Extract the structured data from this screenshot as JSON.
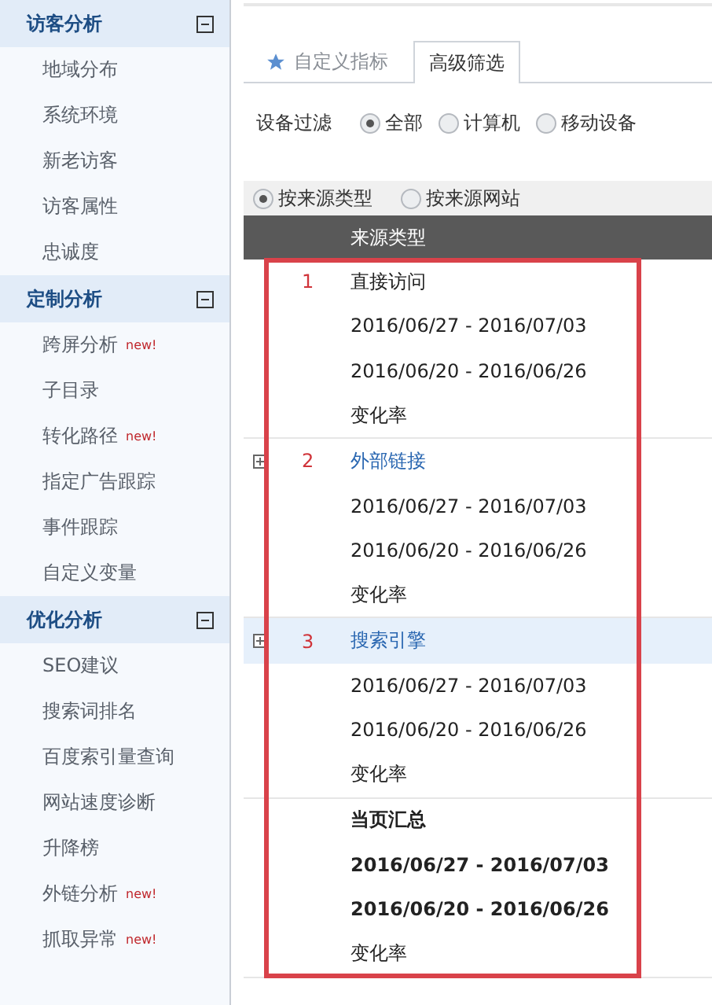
{
  "sidebar": {
    "sections": [
      {
        "title": "访客分析",
        "expanded": true,
        "items": [
          {
            "label": "地域分布"
          },
          {
            "label": "系统环境"
          },
          {
            "label": "新老访客"
          },
          {
            "label": "访客属性"
          },
          {
            "label": "忠诚度"
          }
        ]
      },
      {
        "title": "定制分析",
        "expanded": true,
        "items": [
          {
            "label": "跨屏分析",
            "badge": "new!"
          },
          {
            "label": "子目录"
          },
          {
            "label": "转化路径",
            "badge": "new!"
          },
          {
            "label": "指定广告跟踪"
          },
          {
            "label": "事件跟踪"
          },
          {
            "label": "自定义变量"
          }
        ]
      },
      {
        "title": "优化分析",
        "expanded": true,
        "items": [
          {
            "label": "SEO建议"
          },
          {
            "label": "搜索词排名"
          },
          {
            "label": "百度索引量查询"
          },
          {
            "label": "网站速度诊断"
          },
          {
            "label": "升降榜"
          },
          {
            "label": "外链分析",
            "badge": "new!"
          },
          {
            "label": "抓取异常",
            "badge": "new!"
          }
        ]
      }
    ]
  },
  "tabs": [
    {
      "label": "自定义指标",
      "kind": "starred",
      "selected": false
    },
    {
      "label": "高级筛选",
      "kind": "plain",
      "selected": true
    }
  ],
  "device_filter": {
    "label": "设备过滤",
    "options": [
      {
        "label": "全部",
        "selected": true
      },
      {
        "label": "计算机",
        "selected": false
      },
      {
        "label": "移动设备",
        "selected": false
      }
    ]
  },
  "group_by": [
    {
      "label": "按来源类型",
      "selected": true
    },
    {
      "label": "按来源网站",
      "selected": false
    }
  ],
  "table": {
    "columns": [
      "来源类型"
    ],
    "groups": [
      {
        "rank": "1",
        "name": "直接访问",
        "kind": "plain",
        "expandable": false,
        "highlighted": false,
        "lines": [
          "2016/06/27 - 2016/07/03",
          "2016/06/20 - 2016/06/26",
          "变化率"
        ]
      },
      {
        "rank": "2",
        "name": "外部链接",
        "kind": "link",
        "expandable": true,
        "highlighted": false,
        "lines": [
          "2016/06/27 - 2016/07/03",
          "2016/06/20 - 2016/06/26",
          "变化率"
        ]
      },
      {
        "rank": "3",
        "name": "搜索引擎",
        "kind": "link",
        "expandable": true,
        "highlighted": true,
        "lines": [
          "2016/06/27 - 2016/07/03",
          "2016/06/20 - 2016/06/26",
          "变化率"
        ]
      }
    ],
    "summary": {
      "title": "当页汇总",
      "lines": [
        "2016/06/27 - 2016/07/03",
        "2016/06/20 - 2016/06/26",
        "变化率"
      ]
    }
  }
}
